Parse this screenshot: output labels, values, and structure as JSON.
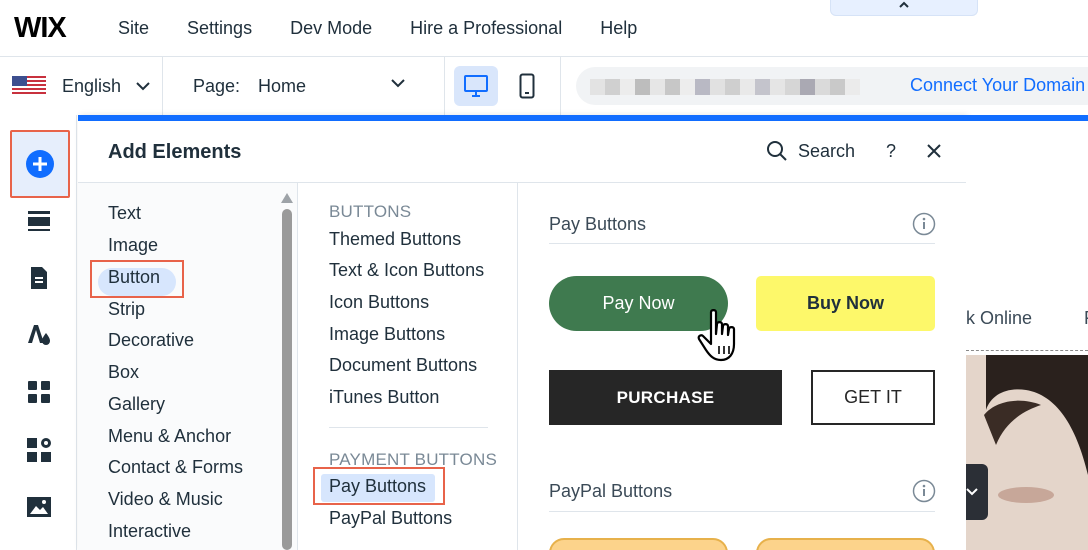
{
  "topbar": {
    "logo": "WIX",
    "menu": [
      "Site",
      "Settings",
      "Dev Mode",
      "Hire a Professional",
      "Help"
    ],
    "collapse_icon": "chevron-up-icon"
  },
  "secondbar": {
    "language": "English",
    "page_label": "Page:",
    "page_value": "Home",
    "connect_domain": "Connect Your Domain"
  },
  "rail": {
    "icons": [
      "add-icon",
      "sections-icon",
      "pages-icon",
      "design-icon",
      "apps-icon",
      "business-icon",
      "media-icon"
    ]
  },
  "panel": {
    "title": "Add Elements",
    "search_label": "Search",
    "help": "?",
    "categories": [
      "Text",
      "Image",
      "Button",
      "Strip",
      "Decorative",
      "Box",
      "Gallery",
      "Menu & Anchor",
      "Contact & Forms",
      "Video & Music",
      "Interactive"
    ],
    "selected_category": "Button",
    "subcategories": {
      "buttons_heading": "BUTTONS",
      "buttons": [
        "Themed Buttons",
        "Text & Icon Buttons",
        "Icon Buttons",
        "Image Buttons",
        "Document Buttons",
        "iTunes Button"
      ],
      "payment_heading": "PAYMENT BUTTONS",
      "payment": [
        "Pay Buttons",
        "PayPal Buttons"
      ],
      "selected": "Pay Buttons"
    },
    "preview": {
      "pay_buttons_title": "Pay Buttons",
      "pay_now": "Pay Now",
      "buy_now": "Buy Now",
      "purchase": "PURCHASE",
      "get_it": "GET IT",
      "paypal_title": "PayPal Buttons"
    }
  },
  "canvas": {
    "nav_text": "k Online",
    "nav_text2": "F"
  },
  "colors": {
    "accent": "#116dff",
    "highlight_outline": "#e8634a",
    "pay_now_bg": "#3f7a4f",
    "buy_now_bg": "#fdf86a",
    "purchase_bg": "#262626"
  }
}
